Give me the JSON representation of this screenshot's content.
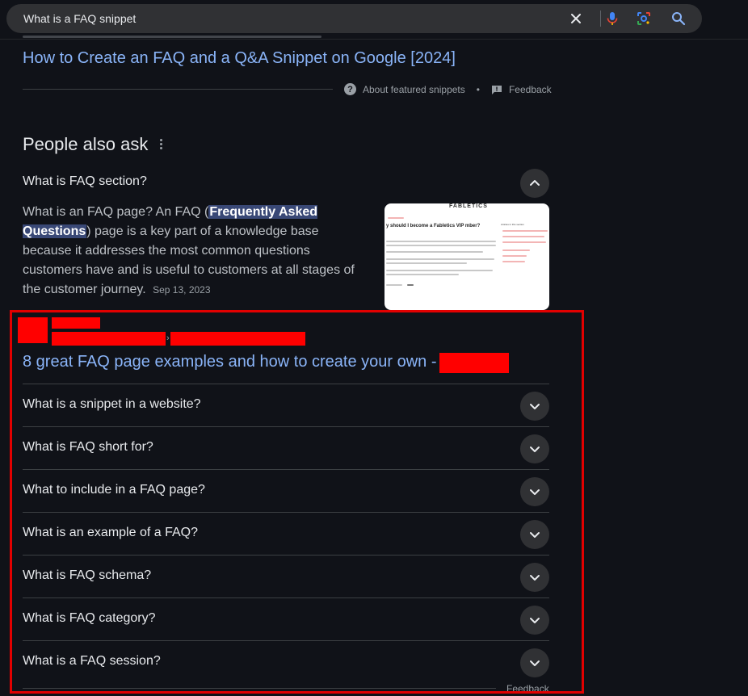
{
  "search": {
    "query": "What is a FAQ snippet",
    "icons": {
      "clear": "close-icon",
      "voice": "microphone-icon",
      "lens": "lens-icon",
      "search": "search-icon"
    }
  },
  "featured_snippet": {
    "title": "How to Create an FAQ and a Q&A Snippet on Google [2024]",
    "about_label": "About featured snippets",
    "separator": "•",
    "feedback_label": "Feedback"
  },
  "people_also_ask": {
    "heading": "People also ask",
    "expanded": {
      "question": "What is FAQ section?",
      "answer_before": "What is an FAQ page? An FAQ (",
      "answer_highlight": "Frequently Asked Questions",
      "answer_after": ") page is a key part of a knowledge base because it addresses the most common questions customers have and is useful to customers at all stages of the customer journey.",
      "date": "Sep 13, 2023",
      "thumbnail": {
        "brand": "FABLETICS",
        "headline": "y should I become a Fabletics VIP mber?",
        "side_heading": "Articles in this section"
      },
      "source": {
        "title": "8 great FAQ page examples and how to create your own -",
        "breadcrumb_separator": "›"
      }
    },
    "questions": [
      "What is a snippet in a website?",
      "What is FAQ short for?",
      "What to include in a FAQ page?",
      "What is an example of a FAQ?",
      "What is FAQ schema?",
      "What is FAQ category?",
      "What is a FAQ session?"
    ],
    "feedback_label": "Feedback"
  },
  "colors": {
    "background": "#101218",
    "link": "#8ab4f8",
    "highlight": "#394876",
    "annotation": "#e20000",
    "redaction": "#ff0000"
  }
}
